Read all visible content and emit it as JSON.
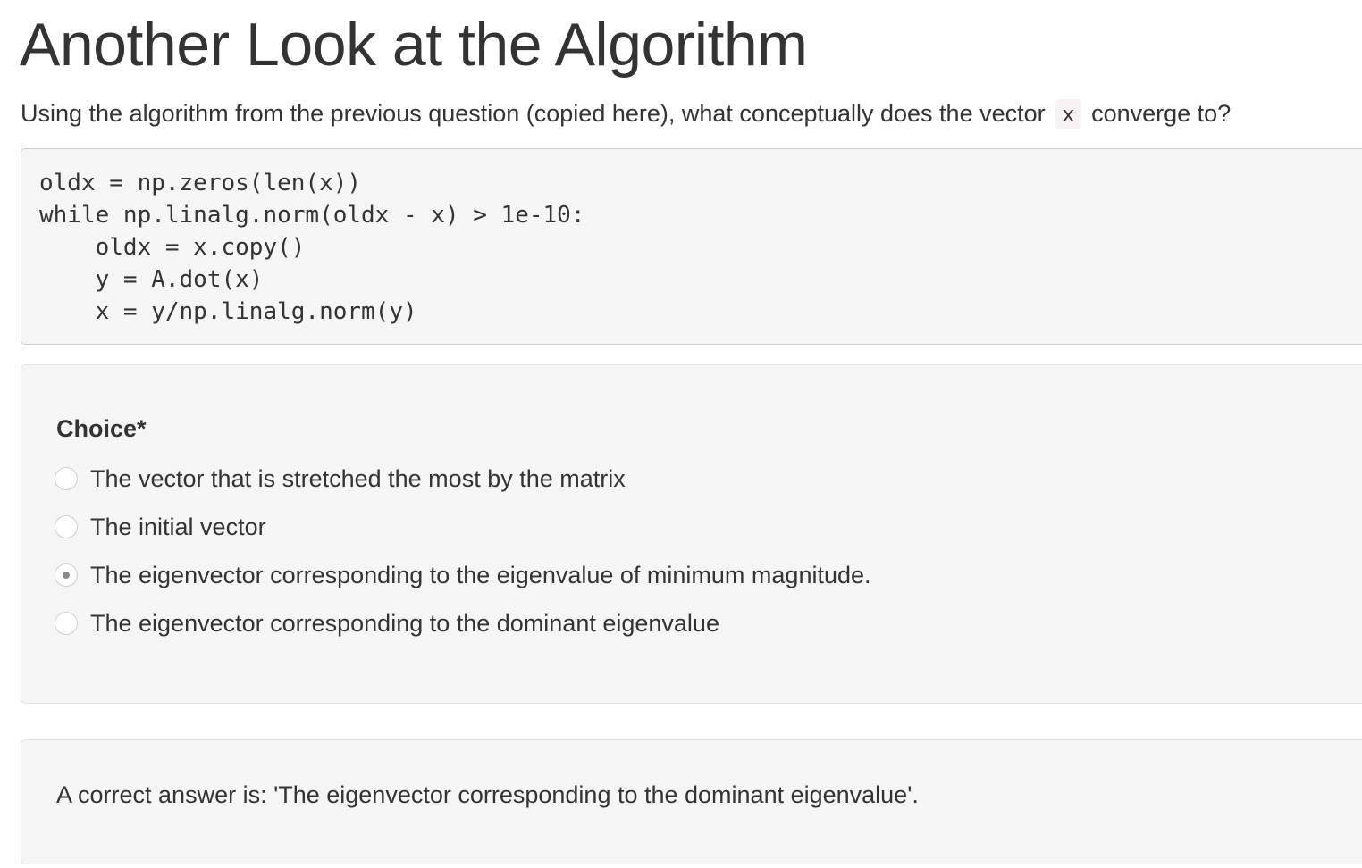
{
  "page": {
    "title": "Another Look at the Algorithm",
    "prompt_before": "Using the algorithm from the previous question (copied here), what conceptually does the vector",
    "prompt_code": "x",
    "prompt_after": "converge to?"
  },
  "code_block": {
    "lines": [
      "oldx = np.zeros(len(x))",
      "while np.linalg.norm(oldx - x) > 1e-10:",
      "    oldx = x.copy()",
      "    y = A.dot(x)",
      "    x = y/np.linalg.norm(y)"
    ]
  },
  "question": {
    "label": "Choice*",
    "options": [
      {
        "text": "The vector that is stretched the most by the matrix",
        "selected": false
      },
      {
        "text": "The initial vector",
        "selected": false
      },
      {
        "text": "The eigenvector corresponding to the eigenvalue of minimum magnitude.",
        "selected": true
      },
      {
        "text": "The eigenvector corresponding to the dominant eigenvalue",
        "selected": false
      }
    ]
  },
  "feedback": {
    "text": "A correct answer is: 'The eigenvector corresponding to the dominant eigenvalue'."
  }
}
